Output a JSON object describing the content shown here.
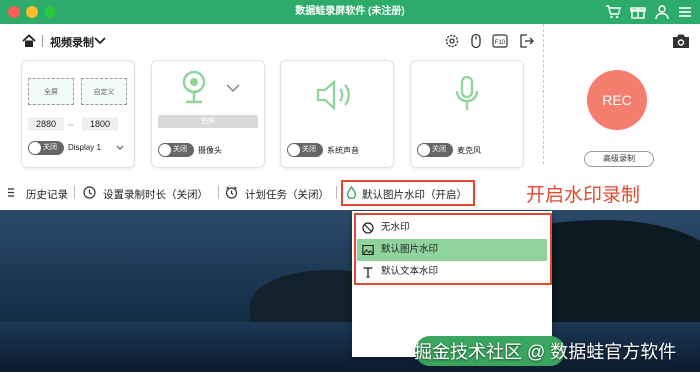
{
  "window": {
    "title": "数据蛙录屏软件 (未注册)"
  },
  "header": {
    "mode_label": "视频录制"
  },
  "screen_card": {
    "fullscreen_label": "全屏",
    "custom_label": "自定义",
    "width": "2880",
    "height": "1800",
    "toggle_text": "关闭",
    "display_label": "Display 1"
  },
  "webcam_card": {
    "disabled_button": "拍照",
    "toggle_text": "关闭",
    "label": "摄像头"
  },
  "system_audio_card": {
    "toggle_text": "关闭",
    "label": "系统声音"
  },
  "mic_card": {
    "toggle_text": "关闭",
    "label": "麦克风"
  },
  "rec_button": "REC",
  "advanced_button": "高级录制",
  "bottom_bar": {
    "history": "历史记录",
    "duration": "设置录制时长（关闭）",
    "schedule": "计划任务（关闭）",
    "watermark": "默认图片水印（开启）"
  },
  "annotation": "开启水印录制",
  "watermark_menu": {
    "items": [
      {
        "label": "无水印",
        "icon": "no-entry-icon",
        "selected": false
      },
      {
        "label": "默认图片水印",
        "icon": "image-icon",
        "selected": true
      },
      {
        "label": "默认文本水印",
        "icon": "text-t-icon",
        "selected": false
      }
    ]
  },
  "page_watermark": "掘金技术社区 @ 数据蛙官方软件",
  "colors": {
    "brand": "#2dab6a",
    "rec": "#f47e6d",
    "annotation": "#e4492e",
    "selected": "#8fd49c"
  }
}
